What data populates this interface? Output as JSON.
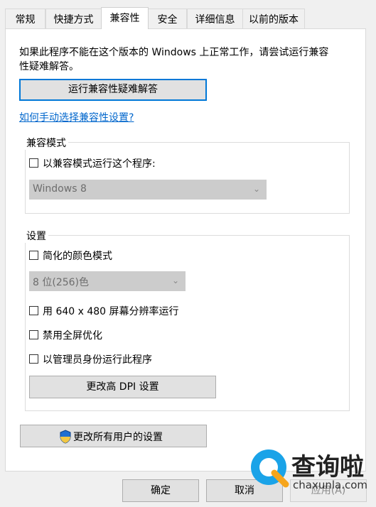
{
  "tabs": [
    "常规",
    "快捷方式",
    "兼容性",
    "安全",
    "详细信息",
    "以前的版本"
  ],
  "intro_text_line1": "如果此程序不能在这个版本的 Windows 上正常工作，请尝试运行兼容",
  "intro_text_line2": "性疑难解答。",
  "troubleshooter_button": "运行兼容性疑难解答",
  "manual_link": "如何手动选择兼容性设置?",
  "compat_mode": {
    "legend": "兼容模式",
    "checkbox_label": "以兼容模式运行这个程序:",
    "os_selected": "Windows 8"
  },
  "settings": {
    "legend": "设置",
    "reduced_color_label": "简化的颜色模式",
    "color_selected": "8 位(256)色",
    "res_640_label": "用 640 x 480 屏幕分辨率运行",
    "fullscreen_opt_label": "禁用全屏优化",
    "run_as_admin_label": "以管理员身份运行此程序",
    "dpi_button": "更改高 DPI 设置"
  },
  "all_users_button": "更改所有用户的设置",
  "footer": {
    "ok": "确定",
    "cancel": "取消",
    "apply": "应用(A)"
  },
  "watermark": {
    "brand": "查询啦",
    "domain": "chaxunla.com"
  }
}
